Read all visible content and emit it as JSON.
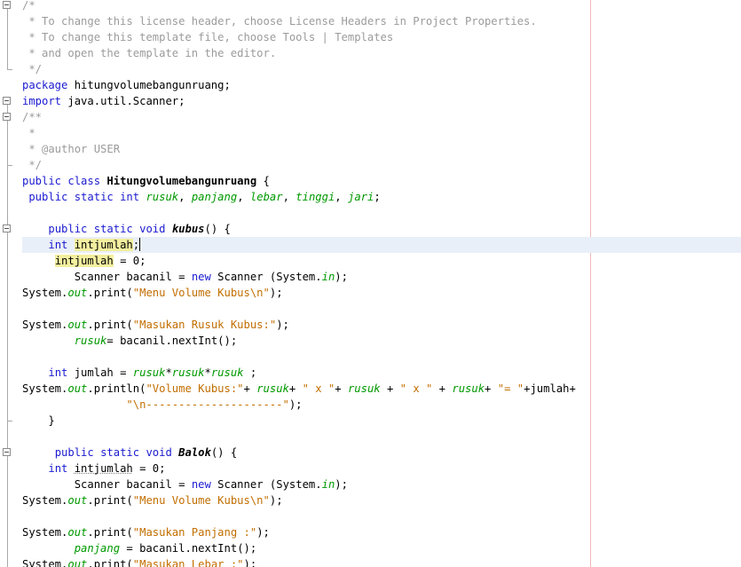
{
  "code_lines": [
    "/*",
    " * To change this license header, choose License Headers in Project Properties.",
    " * To change this template file, choose Tools | Templates",
    " * and open the template in the editor.",
    " */",
    "package hitungvolumebangunruang;",
    "import java.util.Scanner;",
    "/**",
    " *",
    " * @author USER",
    " */",
    "public class Hitungvolumebangunruang {",
    " public static int rusuk, panjang, lebar, tinggi, jari;",
    "",
    "    public static void kubus() {",
    "    int intjumlah;",
    "     intjumlah = 0;",
    "        Scanner bacanil = new Scanner (System.in);",
    "System.out.print(\"Menu Volume Kubus\\n\");",
    "",
    "System.out.print(\"Masukan Rusuk Kubus:\");",
    "        rusuk= bacanil.nextInt();",
    "",
    "    int jumlah = rusuk*rusuk*rusuk ;",
    "System.out.println(\"Volume Kubus:\"+ rusuk+ \" x \"+ rusuk + \" x \" + rusuk+ \"= \"+jumlah+",
    "                \"\\n---------------------\");",
    "    }",
    "",
    "     public static void Balok() {",
    "    int intjumlah = 0;",
    "        Scanner bacanil = new Scanner (System.in);",
    "System.out.print(\"Menu Volume Kubus\\n\");",
    "",
    "System.out.print(\"Masukan Panjang :\");",
    "        panjang = bacanil.nextInt();",
    "System.out.print(\"Masukan Lebar :\");"
  ],
  "colors": {
    "keyword": "#1b1bd0",
    "string": "#c26e00",
    "comment": "#9b9b9b",
    "field": "#009900",
    "current_line": "#e9eff8",
    "highlight": "#f3ef9f",
    "margin_line": "#f2b6b6"
  },
  "icons": [
    "fold-collapse-icon"
  ]
}
